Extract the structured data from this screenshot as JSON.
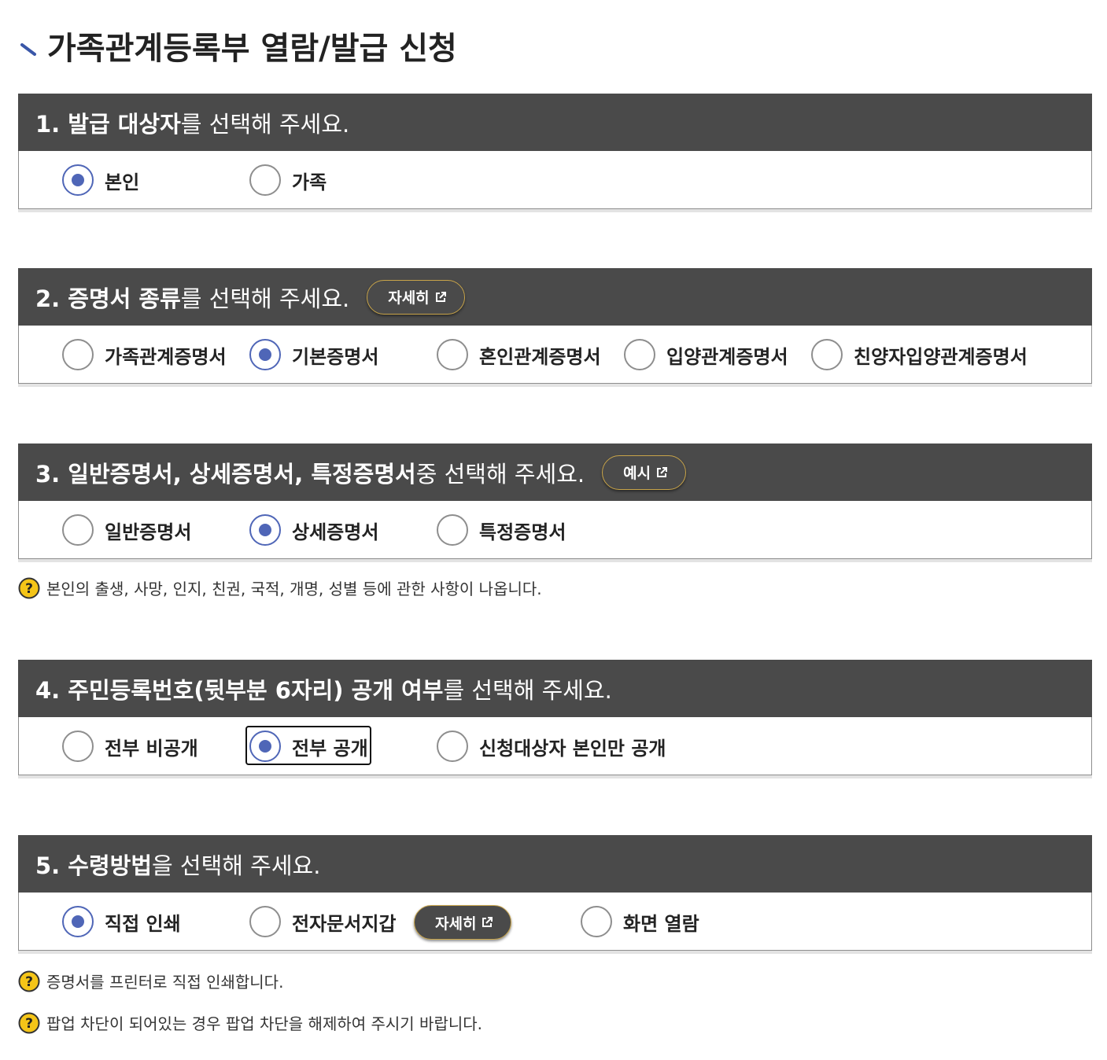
{
  "page_title": "가족관계등록부 열람/발급 신청",
  "colors": {
    "header_bg": "#4a4a4a",
    "radio_selected": "#4f66b7",
    "pill_border": "#c9a54a",
    "help_icon": "#f5c518"
  },
  "section1": {
    "head_bold": "1. 발급 대상자",
    "head_normal": "를 선택해 주세요.",
    "options": [
      {
        "label": "본인",
        "selected": true
      },
      {
        "label": "가족",
        "selected": false
      }
    ]
  },
  "section2": {
    "head_bold": "2. 증명서 종류",
    "head_normal": "를 선택해 주세요.",
    "detail_button": "자세히",
    "options": [
      {
        "label": "가족관계증명서",
        "selected": false
      },
      {
        "label": "기본증명서",
        "selected": true
      },
      {
        "label": "혼인관계증명서",
        "selected": false
      },
      {
        "label": "입양관계증명서",
        "selected": false
      },
      {
        "label": "친양자입양관계증명서",
        "selected": false
      }
    ]
  },
  "section3": {
    "head_bold": "3. 일반증명서, 상세증명서, 특정증명서",
    "head_normal": " 중 선택해 주세요.",
    "example_button": "예시",
    "options": [
      {
        "label": "일반증명서",
        "selected": false
      },
      {
        "label": "상세증명서",
        "selected": true
      },
      {
        "label": "특정증명서",
        "selected": false
      }
    ],
    "help": "본인의 출생, 사망, 인지, 친권, 국적, 개명, 성별 등에 관한 사항이 나옵니다."
  },
  "section4": {
    "head_bold": "4. 주민등록번호(뒷부분 6자리) 공개 여부",
    "head_normal": "를 선택해 주세요.",
    "options": [
      {
        "label": "전부 비공개",
        "selected": false
      },
      {
        "label": "전부 공개",
        "selected": true
      },
      {
        "label": "신청대상자 본인만 공개",
        "selected": false
      }
    ]
  },
  "section5": {
    "head_bold": "5. 수령방법",
    "head_normal": "을 선택해 주세요.",
    "options": [
      {
        "label": "직접 인쇄",
        "selected": true
      },
      {
        "label": "전자문서지갑",
        "selected": false
      },
      {
        "label": "화면 열람",
        "selected": false
      }
    ],
    "wallet_detail_button": "자세히",
    "help1": "증명서를 프린터로 직접 인쇄합니다.",
    "help2": "팝업 차단이 되어있는 경우 팝업 차단을 해제하여 주시기 바랍니다."
  }
}
